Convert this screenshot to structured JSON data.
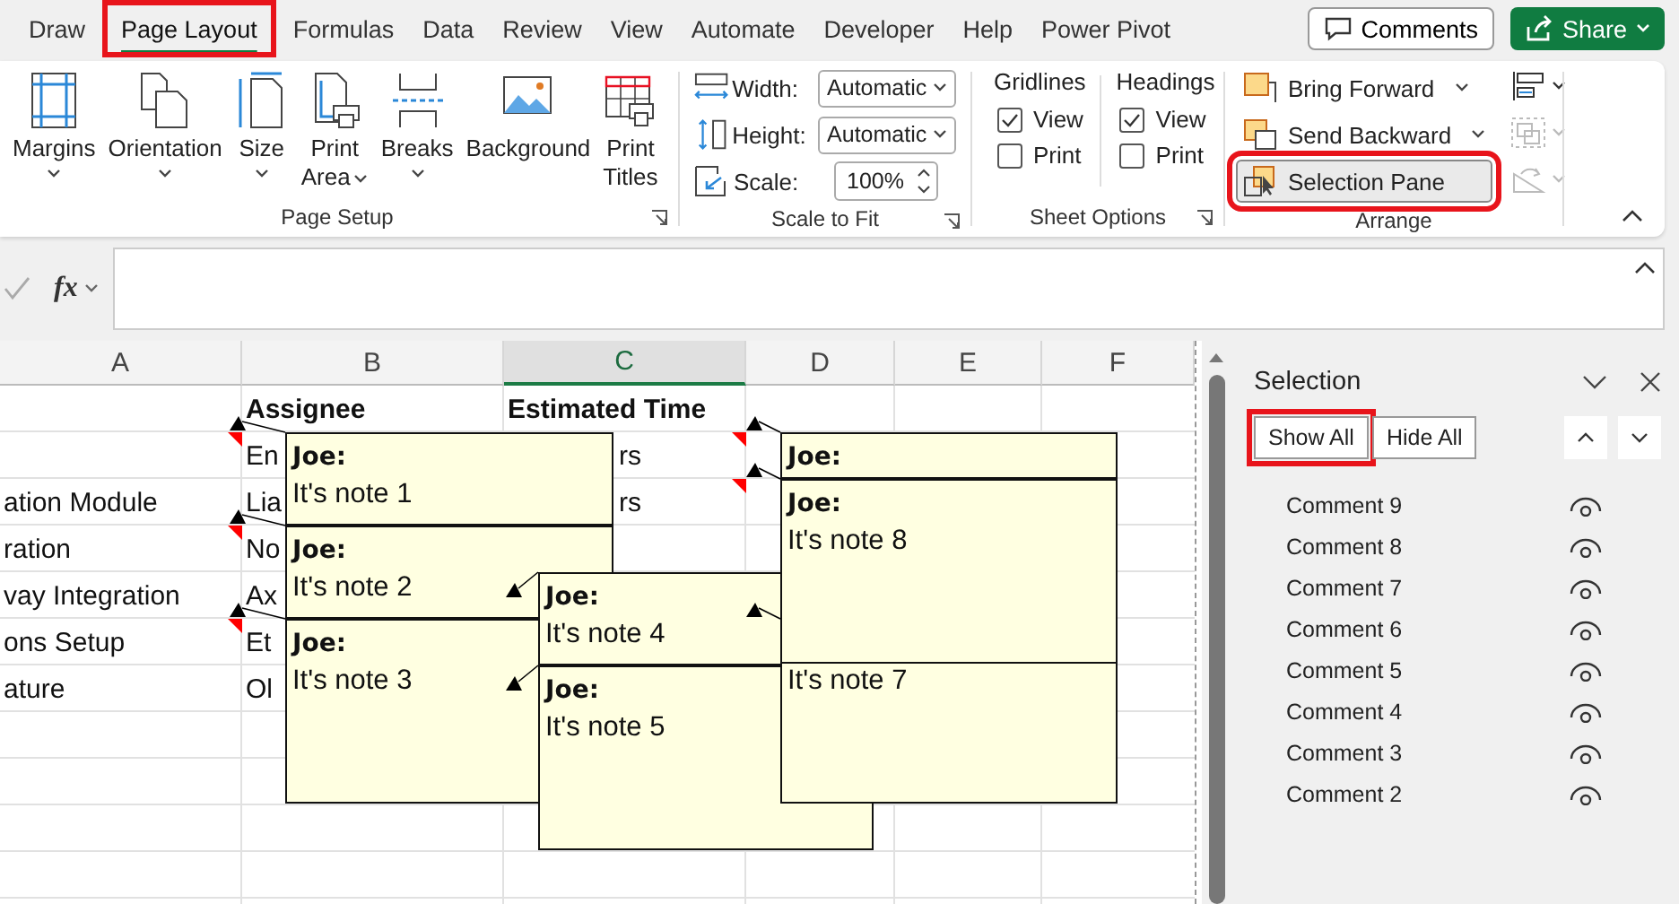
{
  "tabs": [
    {
      "label": "Draw",
      "selected": false,
      "highlighted": false
    },
    {
      "label": "Page Layout",
      "selected": true,
      "highlighted": true
    },
    {
      "label": "Formulas",
      "selected": false,
      "highlighted": false
    },
    {
      "label": "Data",
      "selected": false,
      "highlighted": false
    },
    {
      "label": "Review",
      "selected": false,
      "highlighted": false
    },
    {
      "label": "View",
      "selected": false,
      "highlighted": false
    },
    {
      "label": "Automate",
      "selected": false,
      "highlighted": false
    },
    {
      "label": "Developer",
      "selected": false,
      "highlighted": false
    },
    {
      "label": "Help",
      "selected": false,
      "highlighted": false
    },
    {
      "label": "Power Pivot",
      "selected": false,
      "highlighted": false
    }
  ],
  "header_buttons": {
    "comments": "Comments",
    "share": "Share"
  },
  "page_setup": {
    "label": "Page Setup",
    "buttons": [
      {
        "label": "Margins",
        "caret": true
      },
      {
        "label": "Orientation",
        "caret": true
      },
      {
        "label": "Size",
        "caret": true
      },
      {
        "label": "Print Area",
        "caret": true
      },
      {
        "label": "Breaks",
        "caret": true
      },
      {
        "label": "Background",
        "caret": false
      },
      {
        "label": "Print Titles",
        "caret": false
      }
    ]
  },
  "scale_to_fit": {
    "label": "Scale to Fit",
    "fields": [
      {
        "label": "Width:",
        "value": "Automatic",
        "kind": "select"
      },
      {
        "label": "Height:",
        "value": "Automatic",
        "kind": "select"
      },
      {
        "label": "Scale:",
        "value": "100%",
        "kind": "spin"
      }
    ]
  },
  "sheet_options": {
    "label": "Sheet Options",
    "columns": [
      {
        "title": "Gridlines",
        "options": [
          {
            "label": "View",
            "checked": true
          },
          {
            "label": "Print",
            "checked": false
          }
        ]
      },
      {
        "title": "Headings",
        "options": [
          {
            "label": "View",
            "checked": true
          },
          {
            "label": "Print",
            "checked": false
          }
        ]
      }
    ]
  },
  "arrange": {
    "label": "Arrange",
    "buttons": [
      {
        "label": "Bring Forward",
        "caret": true,
        "pressed": false,
        "highlighted": false
      },
      {
        "label": "Send Backward",
        "caret": true,
        "pressed": false,
        "highlighted": false
      },
      {
        "label": "Selection Pane",
        "caret": false,
        "pressed": true,
        "highlighted": true
      }
    ],
    "small_buttons": [
      {
        "disabled": false
      },
      {
        "disabled": true
      },
      {
        "disabled": true
      }
    ]
  },
  "formula_bar": {
    "function_label": "fx"
  },
  "sheet": {
    "columns": [
      {
        "label": "A",
        "selected": false
      },
      {
        "label": "B",
        "selected": false
      },
      {
        "label": "C",
        "selected": true
      },
      {
        "label": "D",
        "selected": false
      },
      {
        "label": "E",
        "selected": false
      },
      {
        "label": "F",
        "selected": false
      }
    ],
    "rows": [
      {
        "b": "Assignee",
        "c": "Estimated Time",
        "bold": true
      },
      {
        "b": "En",
        "c": "rs",
        "note_a": true,
        "note_c": true
      },
      {
        "a": "ation Module",
        "b": "Lia",
        "c": "rs",
        "note_c": true
      },
      {
        "a": "ration",
        "b": "No",
        "note_a": true
      },
      {
        "a": "vay Integration",
        "b": "Ax"
      },
      {
        "a": "ons Setup",
        "b": "Et",
        "note_a": true
      },
      {
        "a": "ature",
        "b": "Ol"
      }
    ]
  },
  "notes": [
    {
      "author": "Joe:",
      "text": "It's note 1"
    },
    {
      "author": "Joe:",
      "text": "It's note 2"
    },
    {
      "author": "Joe:",
      "text": "It's note 3"
    },
    {
      "author": "Joe:",
      "text": "It's note 4"
    },
    {
      "author": "Joe:",
      "text": "It's note 5"
    },
    {
      "author": "Joe:"
    },
    {
      "author": "Joe:",
      "text": "It's note 8"
    },
    {
      "text": "It's note 7"
    }
  ],
  "selection_pane": {
    "title": "Selection",
    "buttons": [
      {
        "label": "Show All",
        "highlighted": true
      },
      {
        "label": "Hide All",
        "highlighted": false
      }
    ],
    "items": [
      {
        "label": "Comment 9",
        "visible": true
      },
      {
        "label": "Comment 8",
        "visible": true
      },
      {
        "label": "Comment 7",
        "visible": true
      },
      {
        "label": "Comment 6",
        "visible": true
      },
      {
        "label": "Comment 5",
        "visible": true
      },
      {
        "label": "Comment 4",
        "visible": true
      },
      {
        "label": "Comment 3",
        "visible": true
      },
      {
        "label": "Comment 2",
        "visible": true
      }
    ]
  }
}
